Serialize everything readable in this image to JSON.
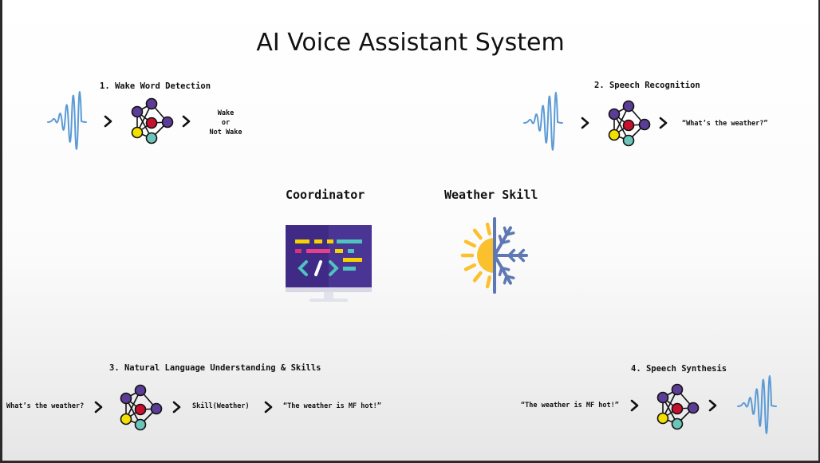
{
  "title": "AI Voice Assistant System",
  "steps": {
    "wake": {
      "label": "1. Wake Word Detection",
      "out_1": "Wake",
      "out_2": "or",
      "out_3": "Not Wake"
    },
    "speech_recognition": {
      "label": "2. Speech Recognition",
      "output": "“What’s the weather?”"
    },
    "nlu": {
      "label": "3. Natural Language Understanding & Skills",
      "input": "What’s the weather?",
      "skill": "Skill(Weather)",
      "output": "“The weather is MF hot!”"
    },
    "synthesis": {
      "label": "4. Speech Synthesis",
      "input": "“The weather is MF hot!”"
    }
  },
  "center": {
    "coordinator": "Coordinator",
    "weather_skill": "Weather Skill"
  },
  "icons": {
    "sound_wave": "sound-wave-icon",
    "arrow": "chevron-right-icon",
    "network": "neural-network-icon",
    "monitor": "code-monitor-icon",
    "weather": "sun-snowflake-icon"
  },
  "colors": {
    "node_purple": "#5b3d97",
    "node_red": "#c8102e",
    "node_yellow": "#f3e000",
    "node_teal": "#6cc5bb",
    "wave_blue": "#5b9bd5",
    "monitor_purple": "#3f2b86",
    "sun": "#fbc02d",
    "snow": "#5e78b3"
  }
}
